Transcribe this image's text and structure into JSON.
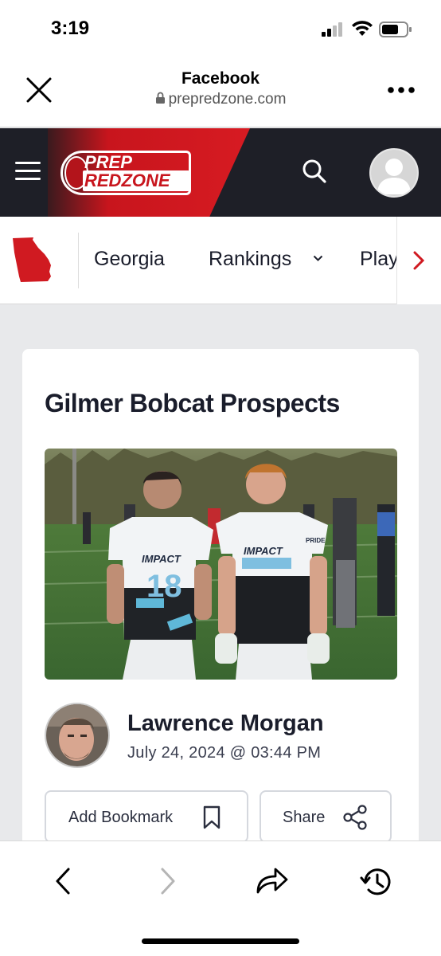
{
  "status_bar": {
    "time": "3:19"
  },
  "browser": {
    "title": "Facebook",
    "url": "prepredzone.com"
  },
  "site": {
    "logo_line1": "PREP",
    "logo_line2": "REDZONE"
  },
  "nav": {
    "items": [
      {
        "label": "Georgia"
      },
      {
        "label": "Rankings"
      },
      {
        "label": "Play"
      }
    ]
  },
  "article": {
    "title": "Gilmer Bobcat Prospects",
    "author": "Lawrence Morgan",
    "date": "July 24, 2024 @ 03:44 PM",
    "bookmark_label": "Add Bookmark",
    "share_label": "Share",
    "image_jersey_text": "IMPACT",
    "image_jersey_numbers": [
      "18"
    ],
    "image_shoulder_text": "PRIDE"
  },
  "colors": {
    "brand_red": "#c8151d",
    "header_dark": "#1e1f27",
    "text_dark": "#1a1d2b"
  }
}
